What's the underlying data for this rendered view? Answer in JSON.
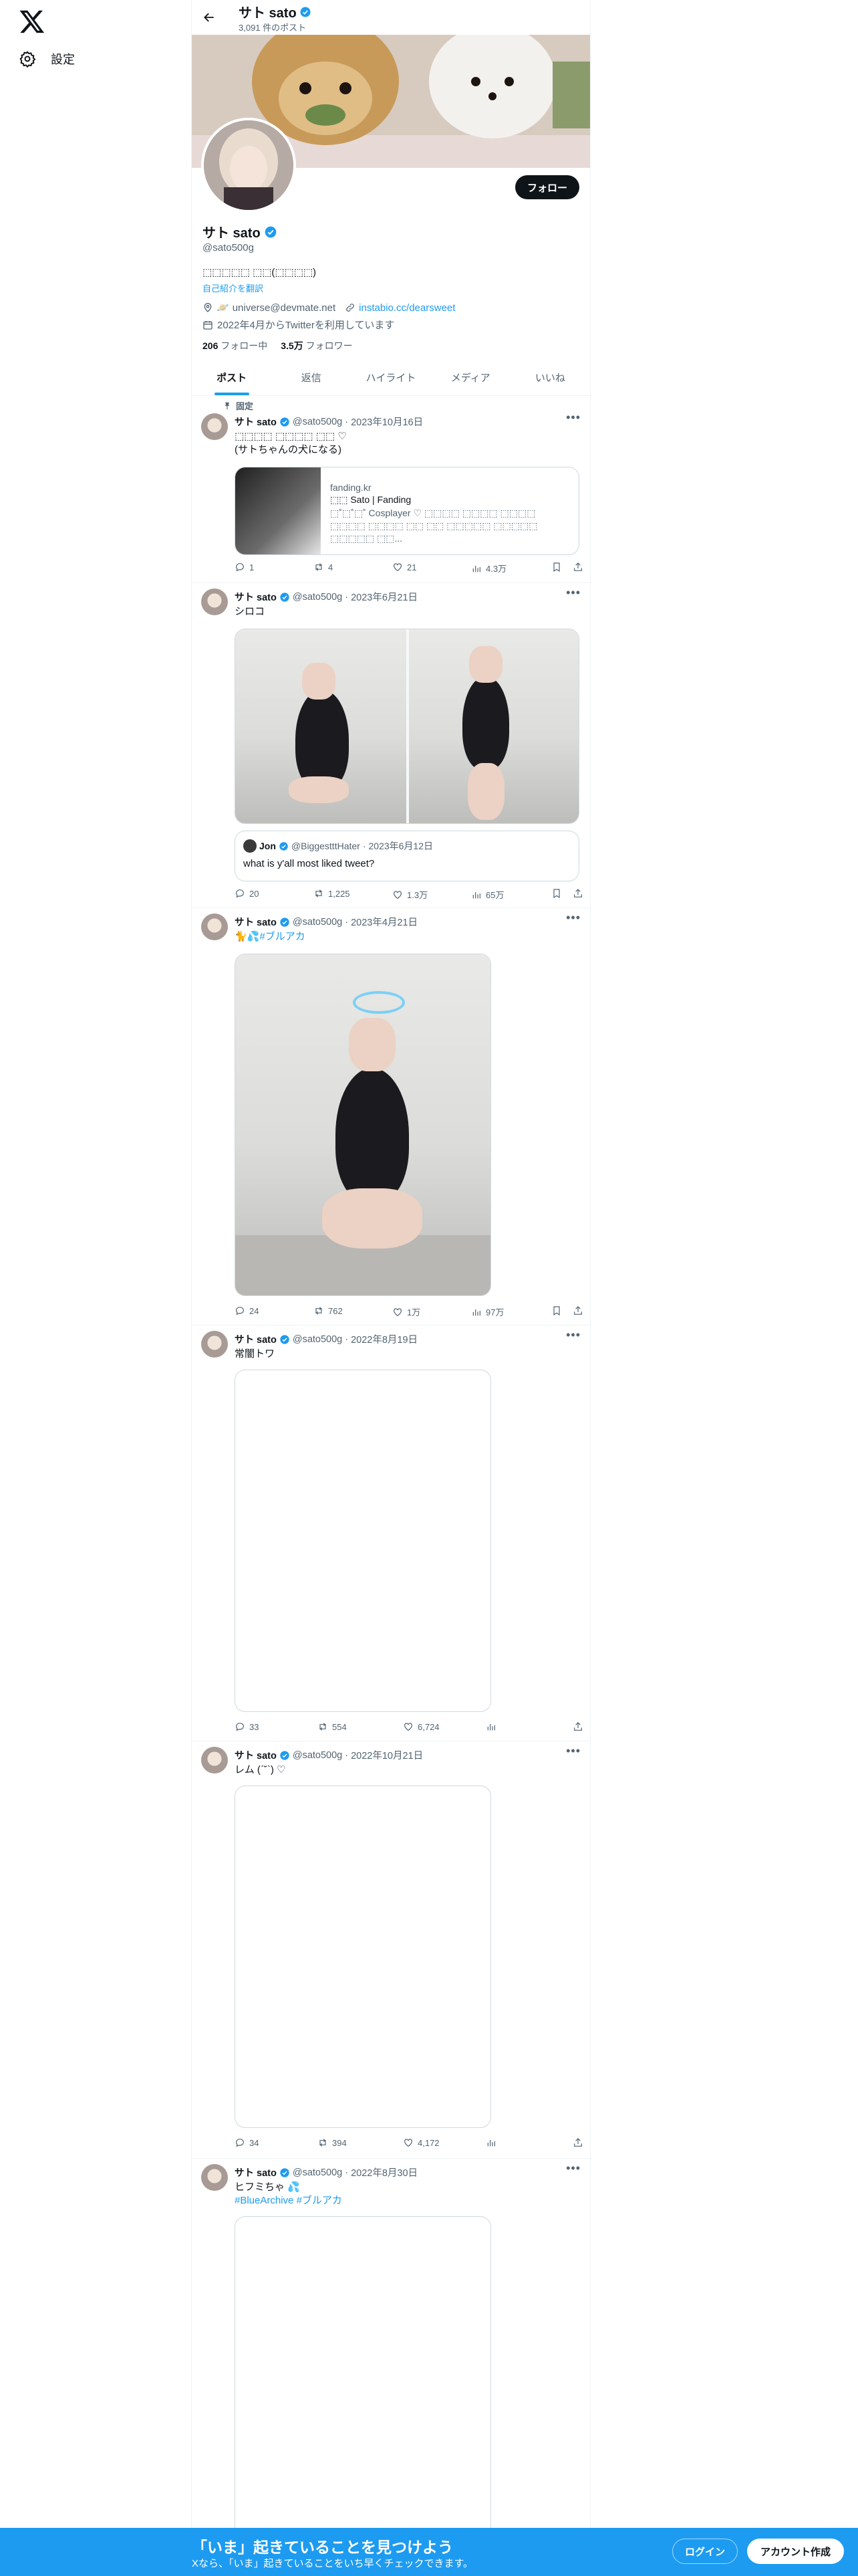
{
  "nav": {
    "settings_label": "設定"
  },
  "topbar": {
    "title": "サト sato",
    "post_count": "3,091 件のポスト"
  },
  "profile": {
    "name": "サト sato",
    "handle": "@sato500g",
    "follow_label": "フォロー",
    "bio": "⬚⬚⬚⬚⬚ ⬚⬚(⬚⬚⬚⬚)",
    "translate_label": "自己紹介を翻訳",
    "location": "universe@devmate.net",
    "website": "instabio.cc/dearsweet",
    "joined": "2022年4月からTwitterを利用しています",
    "following_count": "206",
    "following_label": "フォロー中",
    "followers_count": "3.5万",
    "followers_label": "フォロワー"
  },
  "tabs": [
    {
      "label": "ポスト"
    },
    {
      "label": "返信"
    },
    {
      "label": "ハイライト"
    },
    {
      "label": "メディア"
    },
    {
      "label": "いいね"
    }
  ],
  "pinned_label": "固定",
  "tweets": [
    {
      "name": "サト sato",
      "handle": "@sato500g",
      "date": "2023年10月16日",
      "text_lines": [
        "⬚⬚⬚⬚ ⬚⬚⬚⬚ ⬚⬚ ♡",
        "(サトちゃんの犬になる)"
      ],
      "card": {
        "domain": "fanding.kr",
        "title": "⬚⬚ Sato | Fanding",
        "desc": "⬚˚⬚˚⬚˚ Cosplayer ♡ ⬚⬚⬚⬚ ⬚⬚⬚⬚ ⬚⬚⬚⬚ ⬚⬚⬚⬚ ⬚⬚⬚⬚ ⬚⬚ ⬚⬚ ⬚⬚⬚⬚⬚ ⬚⬚⬚⬚⬚ ⬚⬚⬚⬚⬚ ⬚⬚..."
      },
      "replies": "1",
      "retweets": "4",
      "likes": "21",
      "views": "4.3万"
    },
    {
      "name": "サト sato",
      "handle": "@sato500g",
      "date": "2023年6月21日",
      "text_lines": [
        "シロコ"
      ],
      "quote": {
        "name": "Jon",
        "handle": "@BiggestttHater",
        "date": "2023年6月12日",
        "text": "what is y'all most liked tweet?"
      },
      "replies": "20",
      "retweets": "1,225",
      "likes": "1.3万",
      "views": "65万"
    },
    {
      "name": "サト sato",
      "handle": "@sato500g",
      "date": "2023年4月21日",
      "text_prefix": "🐈💦",
      "hashtag": "#ブルアカ",
      "replies": "24",
      "retweets": "762",
      "likes": "1万",
      "views": "97万"
    },
    {
      "name": "サト sato",
      "handle": "@sato500g",
      "date": "2022年8月19日",
      "text_lines": [
        "常闇トワ"
      ],
      "replies": "33",
      "retweets": "554",
      "likes": "6,724"
    },
    {
      "name": "サト sato",
      "handle": "@sato500g",
      "date": "2022年10月21日",
      "text_lines": [
        "レム (ˊ˘ˋ) ♡"
      ],
      "replies": "34",
      "retweets": "394",
      "likes": "4,172"
    },
    {
      "name": "サト sato",
      "handle": "@sato500g",
      "date": "2022年8月30日",
      "text_lines": [
        "ヒフミちゃ 💦"
      ],
      "hashtags": [
        "#BlueArchive",
        "#ブルアカ"
      ]
    }
  ],
  "bottom_bar": {
    "title": "「いま」起きていることを見つけよう",
    "subtitle": "Xなら、「いま」起きていることをいち早くチェックできます。",
    "login_label": "ログイン",
    "signup_label": "アカウント作成"
  },
  "colors": {
    "accent": "#1d9bf0",
    "text": "#0f1419",
    "muted": "#536471",
    "border": "#eff3f4"
  }
}
